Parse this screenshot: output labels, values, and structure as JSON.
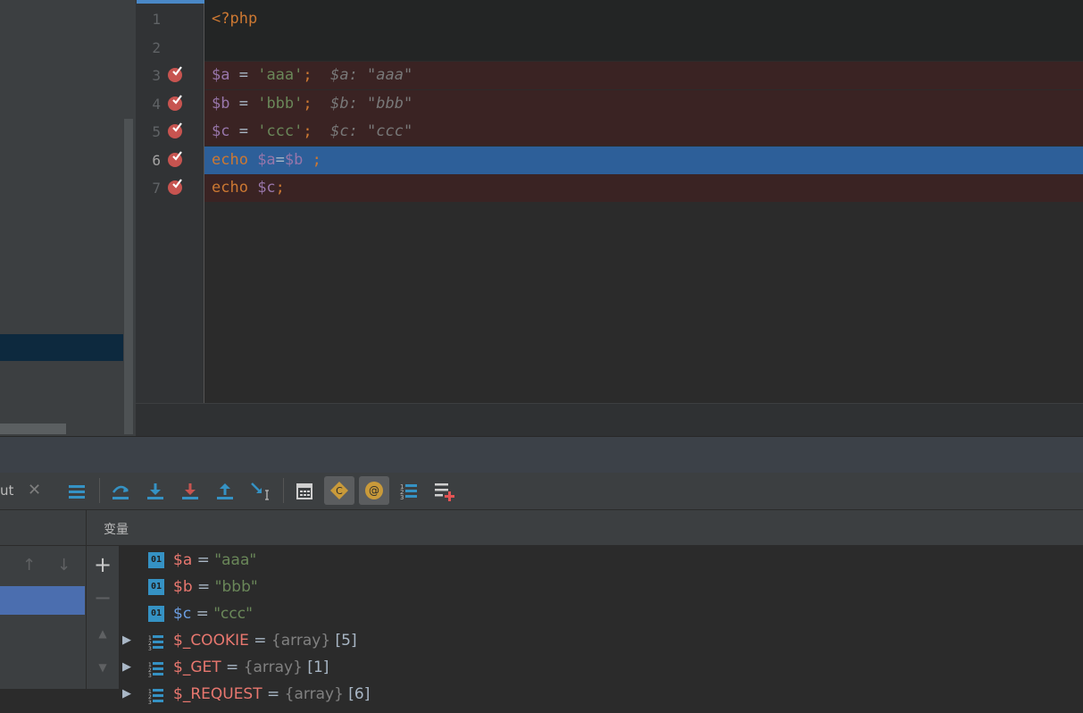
{
  "editor": {
    "lines": [
      {
        "number": "1",
        "code": [
          {
            "text": "<?php",
            "cls": "kw"
          }
        ]
      },
      {
        "number": "2",
        "code": []
      },
      {
        "number": "3",
        "code": [
          {
            "text": "$a",
            "cls": "var"
          },
          {
            "text": " = ",
            "cls": "op"
          },
          {
            "text": "'aaa'",
            "cls": "str"
          },
          {
            "text": ";",
            "cls": "kw"
          },
          {
            "text": "  $a: \"aaa\"",
            "cls": "inl"
          }
        ]
      },
      {
        "number": "4",
        "code": [
          {
            "text": "$b",
            "cls": "var"
          },
          {
            "text": " = ",
            "cls": "op"
          },
          {
            "text": "'bbb'",
            "cls": "str"
          },
          {
            "text": ";",
            "cls": "kw"
          },
          {
            "text": "  $b: \"bbb\"",
            "cls": "inl"
          }
        ]
      },
      {
        "number": "5",
        "code": [
          {
            "text": "$c",
            "cls": "var"
          },
          {
            "text": " = ",
            "cls": "op"
          },
          {
            "text": "'ccc'",
            "cls": "str"
          },
          {
            "text": ";",
            "cls": "kw"
          },
          {
            "text": "  $c: \"ccc\"",
            "cls": "inl"
          }
        ]
      },
      {
        "number": "6",
        "code": [
          {
            "text": "echo ",
            "cls": "kw"
          },
          {
            "text": "$a",
            "cls": "var"
          },
          {
            "text": "=",
            "cls": "op"
          },
          {
            "text": "$b",
            "cls": "var"
          },
          {
            "text": " ;",
            "cls": "kw"
          }
        ]
      },
      {
        "number": "7",
        "code": [
          {
            "text": "echo ",
            "cls": "kw"
          },
          {
            "text": "$c",
            "cls": "var"
          },
          {
            "text": ";",
            "cls": "kw"
          }
        ]
      }
    ],
    "breakpoint_lines": [
      "3",
      "4",
      "5",
      "6",
      "7"
    ],
    "execution_line": "6"
  },
  "debug": {
    "tab_label": "ut",
    "variables_title": "变量",
    "variables": [
      {
        "name": "$a",
        "eq": " = ",
        "value": "\"aaa\"",
        "kind": "string"
      },
      {
        "name": "$b",
        "eq": " = ",
        "value": "\"bbb\"",
        "kind": "string"
      },
      {
        "name": "$c",
        "eq": " = ",
        "value": "\"ccc\"",
        "kind": "string"
      },
      {
        "name": "$_COOKIE",
        "eq": " = ",
        "type": "{array}",
        "size": "[5]",
        "kind": "array"
      },
      {
        "name": "$_GET",
        "eq": " = ",
        "type": "{array}",
        "size": "[1]",
        "kind": "array"
      },
      {
        "name": "$_REQUEST",
        "eq": " = ",
        "type": "{array}",
        "size": "[6]",
        "kind": "array"
      }
    ]
  },
  "colors": {
    "breakpoint": "#c75450",
    "execution_line": "#2d5f99",
    "breakpoint_line": "#3a2323",
    "accent_orange": "#c99a3a"
  }
}
